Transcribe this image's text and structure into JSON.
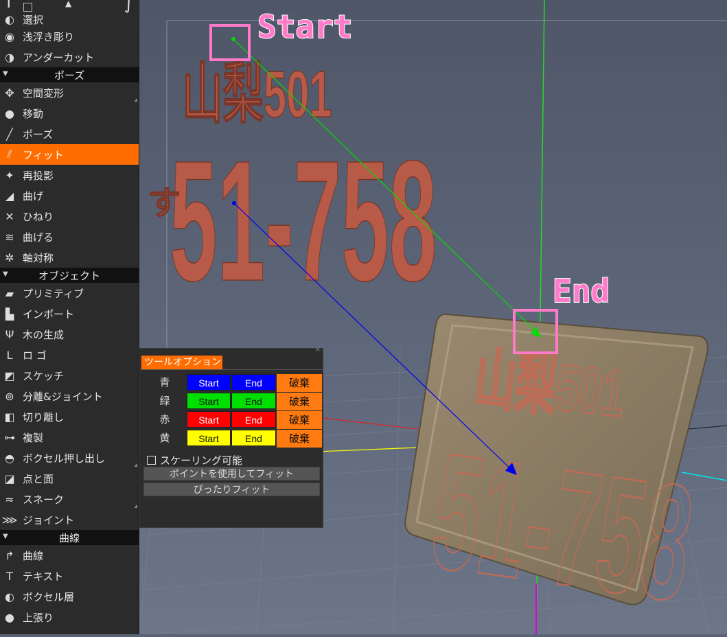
{
  "sidebar": {
    "items_top": [
      {
        "label": "選択",
        "icon": "select-icon"
      },
      {
        "label": "浅浮き彫り",
        "icon": "bas-relief-icon"
      },
      {
        "label": "アンダーカット",
        "icon": "undercut-icon"
      }
    ],
    "sections": [
      {
        "title": "ポーズ",
        "items": [
          {
            "label": "空間変形",
            "icon": "transform-icon",
            "corner": true
          },
          {
            "label": "移動",
            "icon": "move-icon"
          },
          {
            "label": "ポーズ",
            "icon": "pose-icon"
          },
          {
            "label": "フィット",
            "icon": "fit-icon",
            "selected": true
          },
          {
            "label": "再投影",
            "icon": "reproject-icon"
          },
          {
            "label": "曲げ",
            "icon": "bend-icon"
          },
          {
            "label": "ひねり",
            "icon": "twist-icon"
          },
          {
            "label": "曲げる",
            "icon": "warp-icon"
          },
          {
            "label": "軸対称",
            "icon": "axial-symmetry-icon"
          }
        ]
      },
      {
        "title": "オブジェクト",
        "items": [
          {
            "label": "プリミティブ",
            "icon": "primitive-icon"
          },
          {
            "label": "インポート",
            "icon": "import-icon"
          },
          {
            "label": "木の生成",
            "icon": "tree-icon"
          },
          {
            "label": "ロ ゴ",
            "icon": "logo-icon"
          },
          {
            "label": "スケッチ",
            "icon": "sketch-icon"
          },
          {
            "label": "分離&ジョイント",
            "icon": "split-joint-icon"
          },
          {
            "label": "切り離し",
            "icon": "cut-off-icon"
          },
          {
            "label": "複製",
            "icon": "clone-icon"
          },
          {
            "label": "ボクセル押し出し",
            "icon": "voxel-extrude-icon",
            "corner": true
          },
          {
            "label": "点と面",
            "icon": "points-faces-icon"
          },
          {
            "label": "スネーク",
            "icon": "snake-icon",
            "corner": true
          },
          {
            "label": "ジョイント",
            "icon": "joint-icon"
          }
        ]
      },
      {
        "title": "曲線",
        "items": [
          {
            "label": "曲線",
            "icon": "curve-icon"
          },
          {
            "label": "テキスト",
            "icon": "text-icon"
          },
          {
            "label": "ボクセル層",
            "icon": "voxel-layer-icon"
          },
          {
            "label": "上張り",
            "icon": "overlay-icon"
          }
        ]
      }
    ]
  },
  "viewport": {
    "start_label": "Start",
    "end_label": "End",
    "plate_line1": "山梨501",
    "plate_line2": "51-758",
    "plate_prefix": "す"
  },
  "tool_options": {
    "title": "ツールオプション",
    "rows": [
      {
        "label": "青",
        "start": "Start",
        "end": "End",
        "discard": "破棄",
        "color": "#0000ff",
        "text": "#ffffff"
      },
      {
        "label": "緑",
        "start": "Start",
        "end": "End",
        "discard": "破棄",
        "color": "#00e000",
        "text": "#111111"
      },
      {
        "label": "赤",
        "start": "Start",
        "end": "End",
        "discard": "破棄",
        "color": "#ff0000",
        "text": "#ffffff"
      },
      {
        "label": "黄",
        "start": "Start",
        "end": "End",
        "discard": "破棄",
        "color": "#ffff00",
        "text": "#111111"
      }
    ],
    "scaling_label": "スケーリング可能",
    "fit_points_button": "ポイントを使用してフィット",
    "snug_fit_button": "ぴったりフィット"
  }
}
